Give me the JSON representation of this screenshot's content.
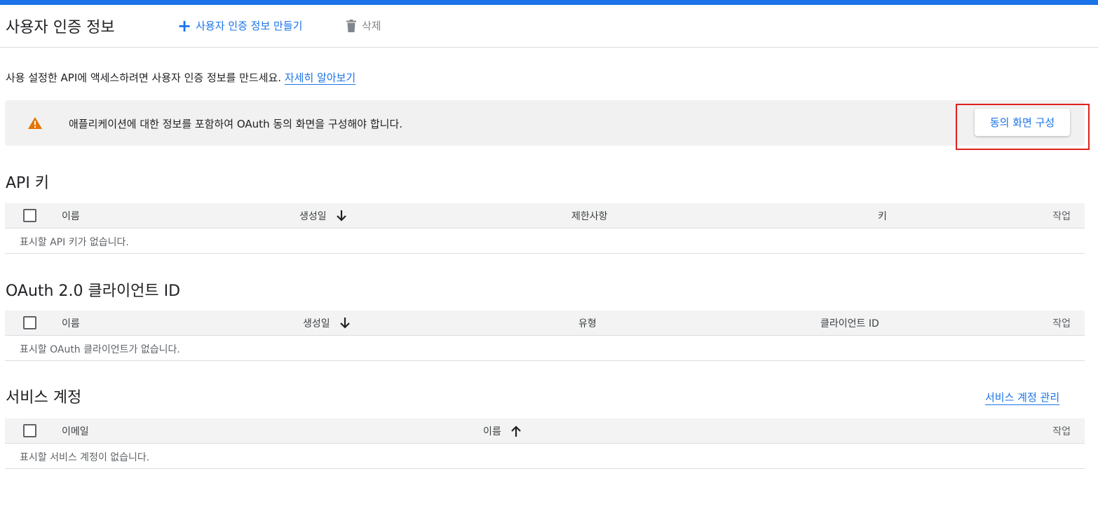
{
  "page": {
    "title": "사용자 인증 정보",
    "accent_color": "#1a73e8",
    "warning_color": "#e37400"
  },
  "toolbar": {
    "create_label": "사용자 인증 정보 만들기",
    "create_icon": "plus-icon",
    "delete_label": "삭제",
    "delete_icon": "trash-icon"
  },
  "intro": {
    "text": "사용 설정한 API에 액세스하려면 사용자 인증 정보를 만드세요.",
    "link_label": "자세히 알아보기"
  },
  "banner": {
    "icon": "warning-icon",
    "message": "애플리케이션에 대한 정보를 포함하여 OAuth 동의 화면을 구성해야 합니다.",
    "button_label": "동의 화면 구성"
  },
  "api_keys": {
    "title": "API 키",
    "columns": {
      "name": "이름",
      "created": "생성일",
      "restrictions": "제한사항",
      "key": "키",
      "actions": "작업"
    },
    "sort": "descending",
    "empty_text": "표시할 API 키가 없습니다."
  },
  "oauth": {
    "title": "OAuth 2.0 클라이언트 ID",
    "columns": {
      "name": "이름",
      "created": "생성일",
      "type": "유형",
      "client_id": "클라이언트 ID",
      "actions": "작업"
    },
    "sort": "descending",
    "empty_text": "표시할 OAuth 클라이언트가 없습니다."
  },
  "service_accounts": {
    "title": "서비스 계정",
    "manage_link": "서비스 계정 관리",
    "columns": {
      "email": "이메일",
      "name": "이름",
      "actions": "작업"
    },
    "sort": "ascending",
    "empty_text": "표시할 서비스 계정이 없습니다."
  }
}
